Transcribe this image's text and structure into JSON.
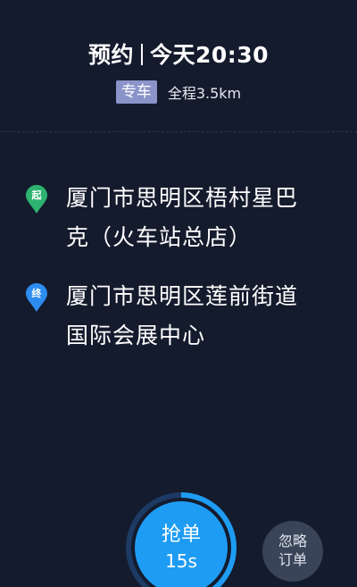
{
  "header": {
    "booking_type": "预约",
    "time": "今天20:30",
    "service_tag": "专车",
    "distance": "全程3.5km"
  },
  "route": {
    "from": {
      "marker": "起",
      "marker_color": "#2db36f",
      "line1": "厦门市思明区梧村星巴",
      "line2": "克（火车站总店）"
    },
    "to": {
      "marker": "终",
      "marker_color": "#2d8cf0",
      "line1": "厦门市思明区莲前街道",
      "line2": "国际会展中心"
    }
  },
  "actions": {
    "grab_label": "抢单",
    "grab_timer": "15s",
    "grab_color": "#1e9cf3",
    "countdown_remaining_fraction": 0.42,
    "ignore_line1": "忽略",
    "ignore_line2": "订单"
  },
  "colors": {
    "background": "#141b2d",
    "tag_bg": "#8b94c9",
    "ignore_bg": "#3a4458"
  }
}
